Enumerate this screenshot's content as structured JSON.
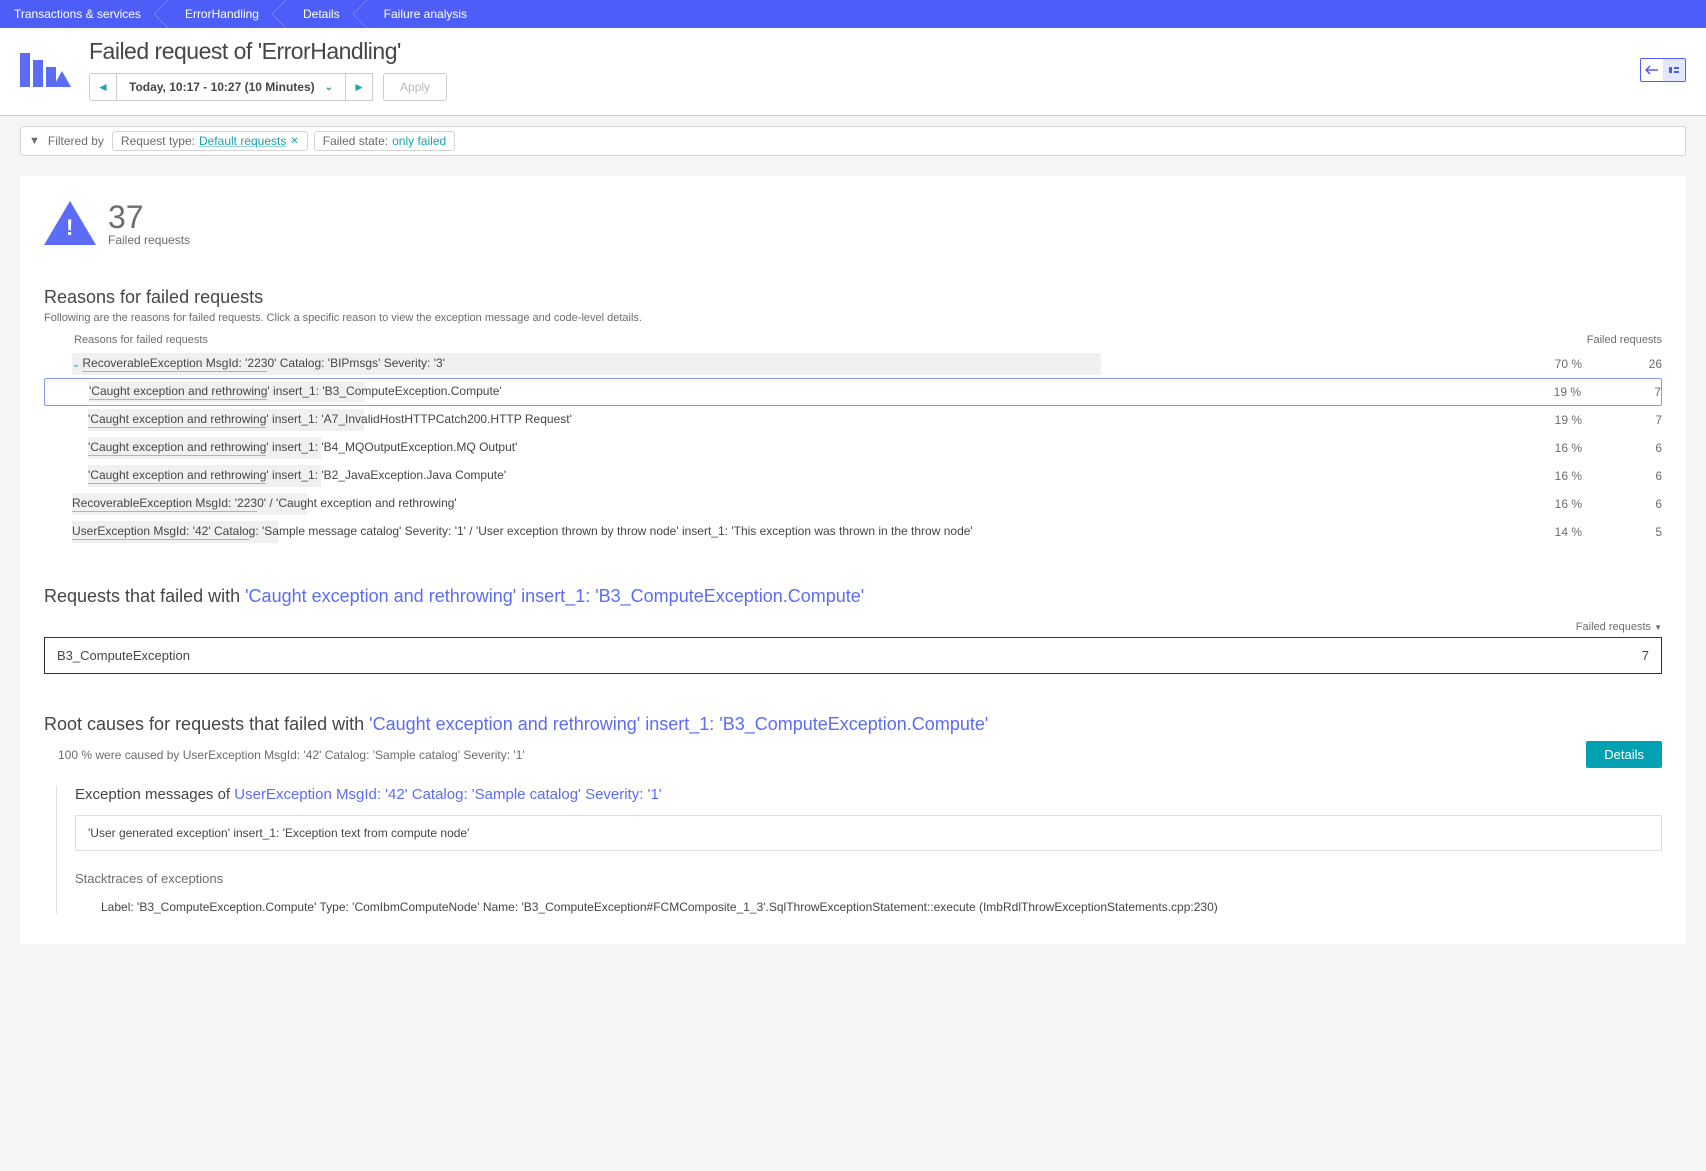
{
  "breadcrumb": {
    "items": [
      "Transactions & services",
      "ErrorHandling",
      "Details",
      "Failure analysis"
    ]
  },
  "header": {
    "title": "Failed request of 'ErrorHandling'",
    "timeframe": "Today, 10:17 - 10:27 (10 Minutes)",
    "apply": "Apply"
  },
  "filters": {
    "label": "Filtered by",
    "chips": [
      {
        "label": "Request type:",
        "value": "Default requests",
        "removable": true
      },
      {
        "label": "Failed state:",
        "value": "only failed",
        "removable": false
      }
    ]
  },
  "summary": {
    "count": "37",
    "label": "Failed requests"
  },
  "reasons": {
    "heading": "Reasons for failed requests",
    "sub": "Following are the reasons for failed requests. Click a specific reason to view the exception message and code-level details.",
    "col_left": "Reasons for failed requests",
    "col_right": "Failed requests",
    "rows": [
      {
        "indent": 0,
        "expanded": true,
        "selected": false,
        "label": "RecoverableException MsgId: '2230' Catalog: 'BIPmsgs' Severity: '3'",
        "pct": "70 %",
        "count": "26",
        "bar": 70,
        "ul": 32
      },
      {
        "indent": 1,
        "expanded": false,
        "selected": true,
        "label": "'Caught exception and rethrowing' insert_1: 'B3_ComputeException.Compute'",
        "pct": "19 %",
        "count": "7",
        "bar": 19,
        "ul": 32
      },
      {
        "indent": 1,
        "expanded": false,
        "selected": false,
        "label": "'Caught exception and rethrowing' insert_1: 'A7_InvalidHostHTTPCatch200.HTTP Request'",
        "pct": "19 %",
        "count": "7",
        "bar": 19,
        "ul": 32
      },
      {
        "indent": 1,
        "expanded": false,
        "selected": false,
        "label": "'Caught exception and rethrowing' insert_1: 'B4_MQOutputException.MQ Output'",
        "pct": "16 %",
        "count": "6",
        "bar": 16,
        "ul": 32
      },
      {
        "indent": 1,
        "expanded": false,
        "selected": false,
        "label": "'Caught exception and rethrowing' insert_1: 'B2_JavaException.Java Compute'",
        "pct": "16 %",
        "count": "6",
        "bar": 16,
        "ul": 32
      },
      {
        "indent": 0,
        "expanded": false,
        "selected": false,
        "label": "RecoverableException MsgId: '2230' / 'Caught exception and rethrowing'",
        "pct": "16 %",
        "count": "6",
        "bar": 16,
        "ul": 32
      },
      {
        "indent": 0,
        "expanded": false,
        "selected": false,
        "label": "UserException MsgId: '42' Catalog: 'Sample message catalog' Severity: '1' / 'User exception thrown by throw node' insert_1: 'This exception was thrown in the throw node'",
        "pct": "14 %",
        "count": "5",
        "bar": 14,
        "ul": 32
      }
    ]
  },
  "failedWith": {
    "prefix": "Requests that failed with ",
    "em": "'Caught exception and rethrowing' insert_1: 'B3_ComputeException.Compute'",
    "header": "Failed requests",
    "boxLabel": "B3_ComputeException",
    "boxCount": "7"
  },
  "rootCauses": {
    "prefix": "Root causes for requests that failed with ",
    "em": "'Caught exception and rethrowing' insert_1: 'B3_ComputeException.Compute'",
    "line": "100 % were caused by UserException MsgId: '42' Catalog: 'Sample catalog' Severity: '1'",
    "detailsBtn": "Details",
    "excPrefix": "Exception messages of ",
    "excEm": "UserException MsgId: '42' Catalog: 'Sample catalog' Severity: '1'",
    "msg": "'User generated exception' insert_1: 'Exception text from compute node'",
    "stkHeading": "Stacktraces of exceptions",
    "stkLine": "Label: 'B3_ComputeException.Compute' Type: 'ComIbmComputeNode' Name: 'B3_ComputeException#FCMComposite_1_3'.SqlThrowExceptionStatement::execute (ImbRdlThrowExceptionStatements.cpp:230)"
  }
}
